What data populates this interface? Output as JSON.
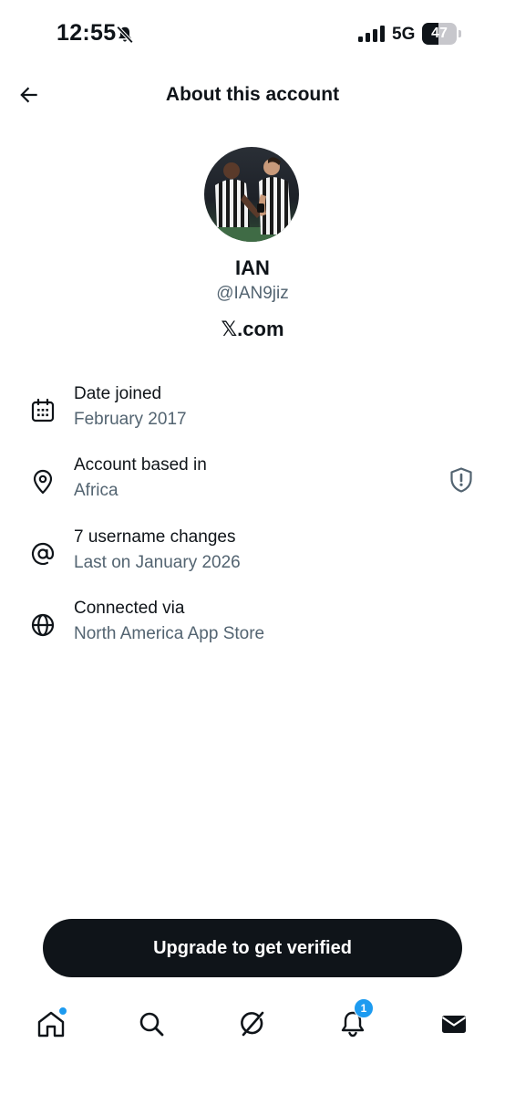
{
  "status_bar": {
    "time": "12:55",
    "network": "5G",
    "battery_level": "47",
    "battery_fraction": 0.47
  },
  "header": {
    "title": "About this account",
    "back_icon": "arrow-left-icon"
  },
  "profile": {
    "display_name": "IAN",
    "username": "@IAN9jiz",
    "site": "𝕏.com"
  },
  "info": [
    {
      "icon": "calendar-icon",
      "label": "Date joined",
      "value": "February 2017"
    },
    {
      "icon": "location-pin-icon",
      "label": "Account based in",
      "value": "Africa",
      "trailing_icon": "shield-alert-icon"
    },
    {
      "icon": "at-sign-icon",
      "label": "7 username changes",
      "value": "Last on January 2026"
    },
    {
      "icon": "globe-icon",
      "label": "Connected via",
      "value": "North America App Store"
    }
  ],
  "cta": {
    "label": "Upgrade to get verified"
  },
  "bottom_nav": {
    "items": [
      {
        "icon": "home-icon",
        "has_dot": true
      },
      {
        "icon": "search-icon"
      },
      {
        "icon": "grok-icon"
      },
      {
        "icon": "bell-icon",
        "badge": "1"
      },
      {
        "icon": "mail-icon"
      }
    ]
  },
  "colors": {
    "text_primary": "#0f1419",
    "text_secondary": "#536471",
    "accent": "#1d9bf0",
    "button_bg": "#0f1419"
  }
}
